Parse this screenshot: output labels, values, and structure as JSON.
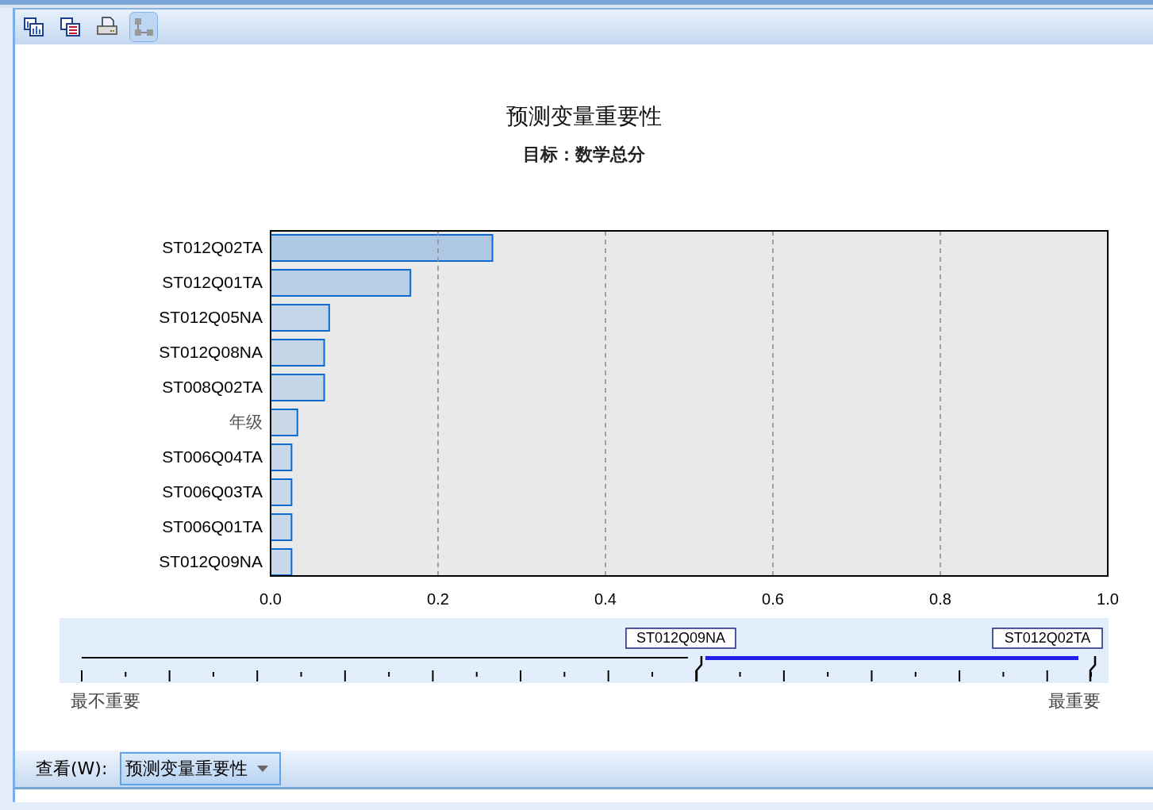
{
  "toolbar": [
    {
      "kind": "chart",
      "selected": false
    },
    {
      "kind": "table",
      "selected": false
    },
    {
      "kind": "print",
      "selected": false
    },
    {
      "kind": "network",
      "selected": true
    }
  ],
  "chart": {
    "title": "预测变量重要性",
    "subtitle": "目标：数学总分",
    "chart_data": {
      "type": "bar",
      "orientation": "horizontal",
      "categories": [
        "ST012Q02TA",
        "ST012Q01TA",
        "ST012Q05NA",
        "ST012Q08NA",
        "ST008Q02TA",
        "年级",
        "ST006Q04TA",
        "ST006Q03TA",
        "ST006Q01TA",
        "ST012Q09NA"
      ],
      "values": [
        0.265,
        0.167,
        0.07,
        0.064,
        0.064,
        0.032,
        0.025,
        0.025,
        0.025,
        0.025
      ],
      "grid": true,
      "xlim": [
        0,
        1
      ],
      "xticks": [
        {
          "value": 0,
          "label": "0.0"
        },
        {
          "value": 0.2,
          "label": "0.2"
        },
        {
          "value": 0.4,
          "label": "0.4"
        },
        {
          "value": 0.6,
          "label": "0.6"
        },
        {
          "value": 0.8,
          "label": "0.8"
        },
        {
          "value": 1,
          "label": "1.0"
        }
      ]
    }
  },
  "range_slider": {
    "handles": [
      {
        "label": "ST012Q09NA",
        "level": 0.61
      },
      {
        "label": "ST012Q02TA",
        "level": 1.0
      }
    ],
    "min_label": "最不重要",
    "max_label": "最重要"
  },
  "view": {
    "label": "查看(W):",
    "value": "预测变量重要性"
  }
}
